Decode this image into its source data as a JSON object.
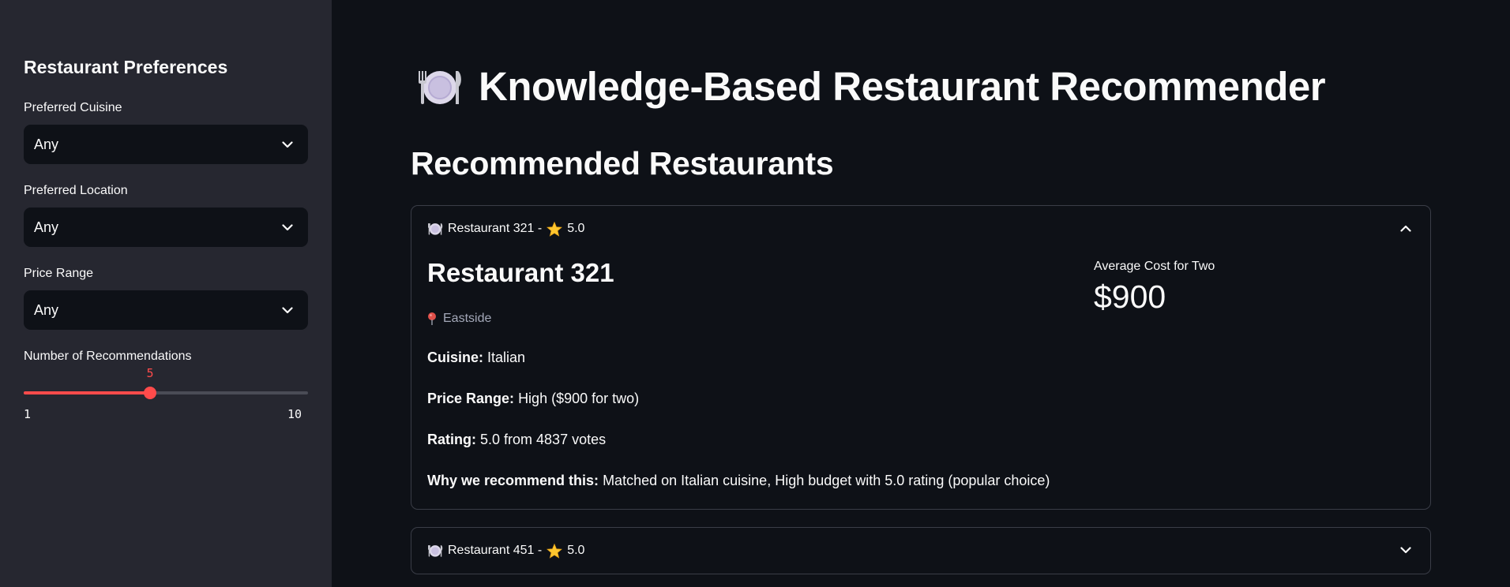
{
  "sidebar": {
    "title": "Restaurant Preferences",
    "cuisine": {
      "label": "Preferred Cuisine",
      "value": "Any"
    },
    "location": {
      "label": "Preferred Location",
      "value": "Any"
    },
    "price": {
      "label": "Price Range",
      "value": "Any"
    },
    "num_recs": {
      "label": "Number of Recommendations",
      "value": "5",
      "min": "1",
      "max": "10",
      "fraction": 0.4444
    }
  },
  "main": {
    "title": "Knowledge-Based Restaurant Recommender",
    "title_icon": "plate-cutlery-icon",
    "section_title": "Recommended Restaurants",
    "restaurants": [
      {
        "header_name": "Restaurant 321 -",
        "header_rating": "5.0",
        "expanded": true,
        "name": "Restaurant 321",
        "location": "Eastside",
        "cuisine_label": "Cuisine:",
        "cuisine": "Italian",
        "price_label": "Price Range:",
        "price": "High ($900 for two)",
        "rating_label": "Rating:",
        "rating": "5.0 from 4837 votes",
        "why_label": "Why we recommend this:",
        "why": "Matched on Italian cuisine, High budget with 5.0 rating (popular choice)",
        "metric_label": "Average Cost for Two",
        "metric_value": "$900"
      },
      {
        "header_name": "Restaurant 451 -",
        "header_rating": "5.0",
        "expanded": false
      }
    ]
  },
  "colors": {
    "accent": "#ff4b4b",
    "background": "#0e1117",
    "sidebar": "#262730"
  }
}
